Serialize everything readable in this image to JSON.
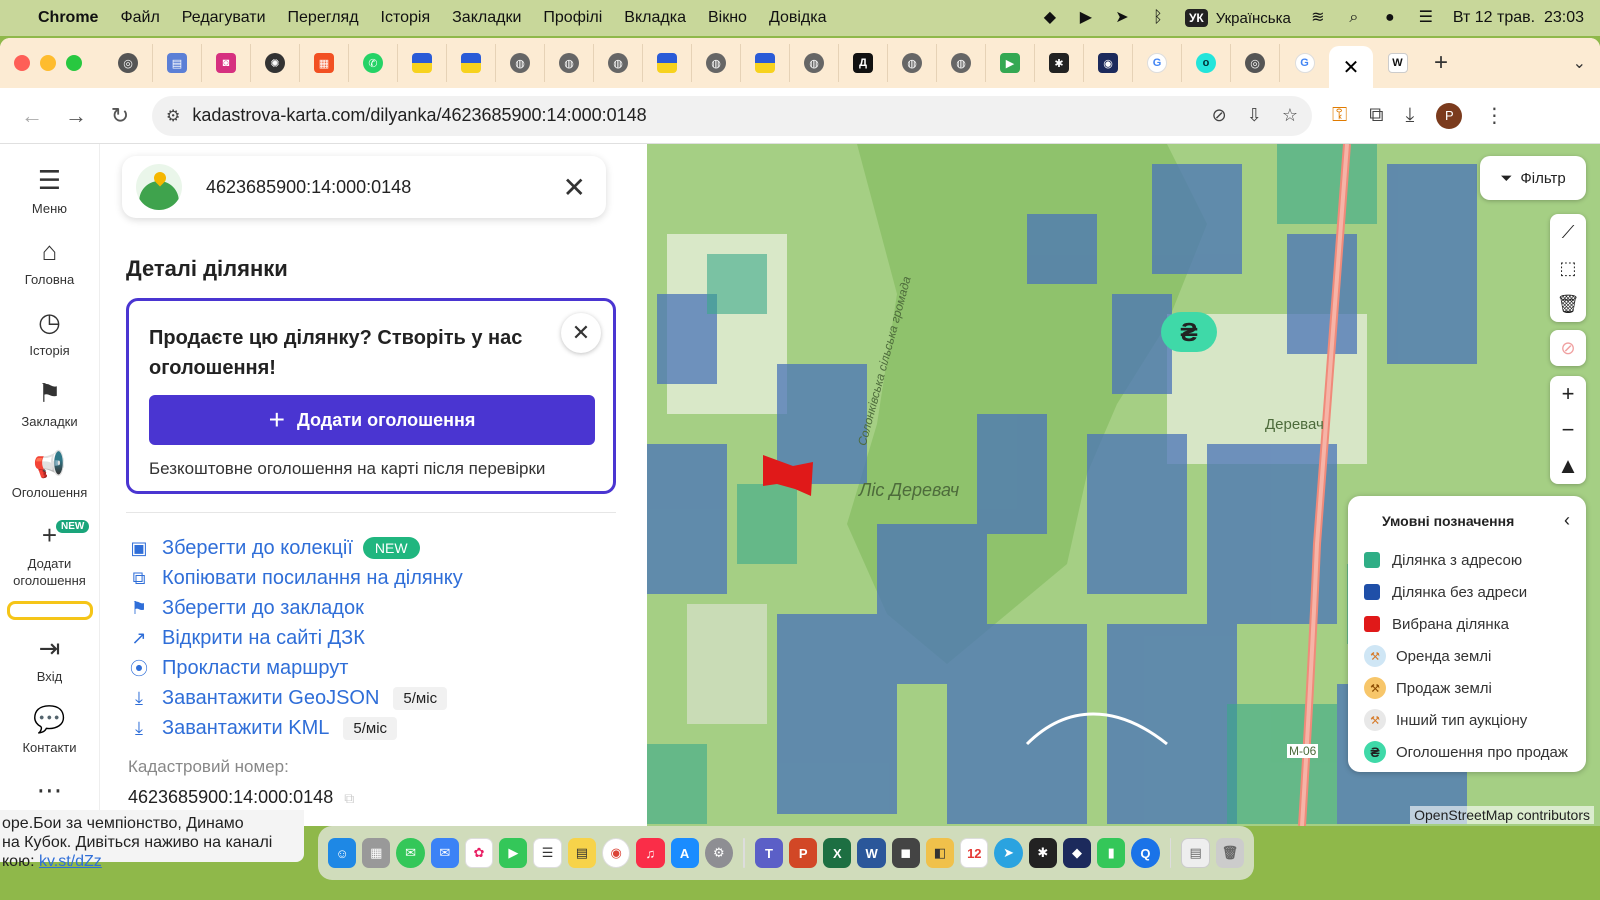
{
  "menubar": {
    "app": "Chrome",
    "items": [
      "Файл",
      "Редагувати",
      "Перегляд",
      "Історія",
      "Закладки",
      "Профілі",
      "Вкладка",
      "Вікно",
      "Довідка"
    ],
    "keyboard": "УК",
    "language": "Українська",
    "datetime": "Вт 12 трав.  23:03"
  },
  "browser": {
    "url": "kadastrova-karta.com/dilyanka/4623685900:14:000:0148",
    "profile_initial": "P"
  },
  "leftnav": {
    "menu": "Меню",
    "home": "Головна",
    "history": "Історія",
    "bookmarks": "Закладки",
    "ads": "Оголошення",
    "add_ad": "Додати оголошення",
    "new_badge": "NEW",
    "login": "Вхід",
    "contacts": "Контакти"
  },
  "panel": {
    "search_value": "4623685900:14:000:0148",
    "title": "Деталі ділянки",
    "promo_text": "Продаєте цю ділянку? Створіть у нас оголошення!",
    "promo_button": "Додати оголошення",
    "promo_note": "Безкоштовне оголошення на карті після перевірки",
    "actions": [
      {
        "label": "Зберегти до колекції",
        "tag": "NEW"
      },
      {
        "label": "Копіювати посилання на ділянку"
      },
      {
        "label": "Зберегти до закладок"
      },
      {
        "label": "Відкрити на сайті ДЗК"
      },
      {
        "label": "Прокласти маршрут"
      },
      {
        "label": "Завантажити GeoJSON",
        "quota": "5/міс"
      },
      {
        "label": "Завантажити KML",
        "quota": "5/міс"
      }
    ],
    "cad_label": "Кадастровий номер:",
    "cad_value": "4623685900:14:000:0148"
  },
  "map": {
    "filter_label": "Фільтр",
    "label_forest": "Ліс Деревач",
    "label_community": "Солонківська сільська громада",
    "label_village": "Деревач",
    "label_road": "М-06",
    "attribution": "OpenStreetMap contributors",
    "legend": {
      "title": "Умовні позначення",
      "items": [
        {
          "label": "Ділянка з адресою",
          "color": "#2fae86"
        },
        {
          "label": "Ділянка без адреси",
          "color": "#1f4fa8"
        },
        {
          "label": "Вибрана ділянка",
          "color": "#e01919"
        },
        {
          "label": "Оренда землі",
          "color": "#cfe6f5"
        },
        {
          "label": "Продаж землі",
          "color": "#f7c66a"
        },
        {
          "label": "Інший тип аукціону",
          "color": "#e8e8e8"
        },
        {
          "label": "Оголошення про продаж",
          "color": "#3fd9a8"
        }
      ]
    }
  },
  "notification": {
    "line1": "оре.Бои за чемпіонство, Динамо",
    "line2": "на Кубок. Дивіться наживо на каналі",
    "line3_prefix": "кою: ",
    "link": "kv.st/dZz"
  },
  "dock": {
    "calendar_day": "12"
  }
}
